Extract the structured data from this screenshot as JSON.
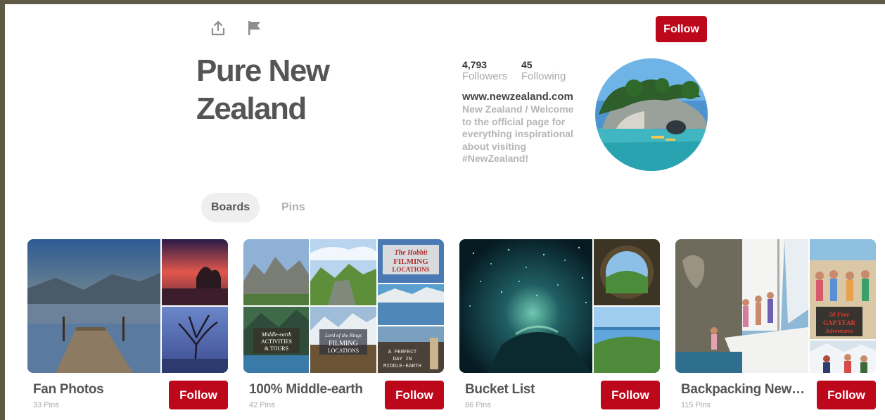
{
  "profile": {
    "name": "Pure New Zealand",
    "follow_label": "Follow",
    "followers_count": "4,793",
    "followers_label": "Followers",
    "following_count": "45",
    "following_label": "Following",
    "website": "www.newzealand.com",
    "bio": "New Zealand / Welcome to the official page for everything inspirational about visiting #NewZealand!"
  },
  "icons": {
    "share": "share-icon",
    "flag": "flag-icon"
  },
  "tabs": [
    {
      "label": "Boards",
      "active": true
    },
    {
      "label": "Pins",
      "active": false
    }
  ],
  "boards": [
    {
      "name": "Fan Photos",
      "pins": "33 Pins",
      "follow_label": "Follow"
    },
    {
      "name": "100% Middle-earth",
      "pins": "42 Pins",
      "follow_label": "Follow",
      "cover_text": {
        "hobbit_line1": "The Hobbit",
        "hobbit_line2": "FILMING",
        "hobbit_line3": "LOCATIONS",
        "me_line1": "Middle-earth",
        "me_line2": "ACTIVITIES",
        "me_line3": "& TOURS",
        "lotr_line1": "Lord of the Rings",
        "lotr_line2": "FILMING",
        "lotr_line3": "LOCATIONS",
        "day_line1": "A PERFECT",
        "day_line2": "DAY IN",
        "day_line3": "MIDDLE-EARTH"
      }
    },
    {
      "name": "Bucket List",
      "pins": "86 Pins",
      "follow_label": "Follow"
    },
    {
      "name": "Backpacking New Zealand",
      "pins": "115 Pins",
      "follow_label": "Follow",
      "cover_text": {
        "gap_line1": "50 Free",
        "gap_line2": "GAP YEAR",
        "gap_line3": "Adventures"
      }
    }
  ],
  "colors": {
    "brand_red": "#bd081c",
    "frame": "#5e5a45",
    "muted_text": "#aaaaaa"
  }
}
